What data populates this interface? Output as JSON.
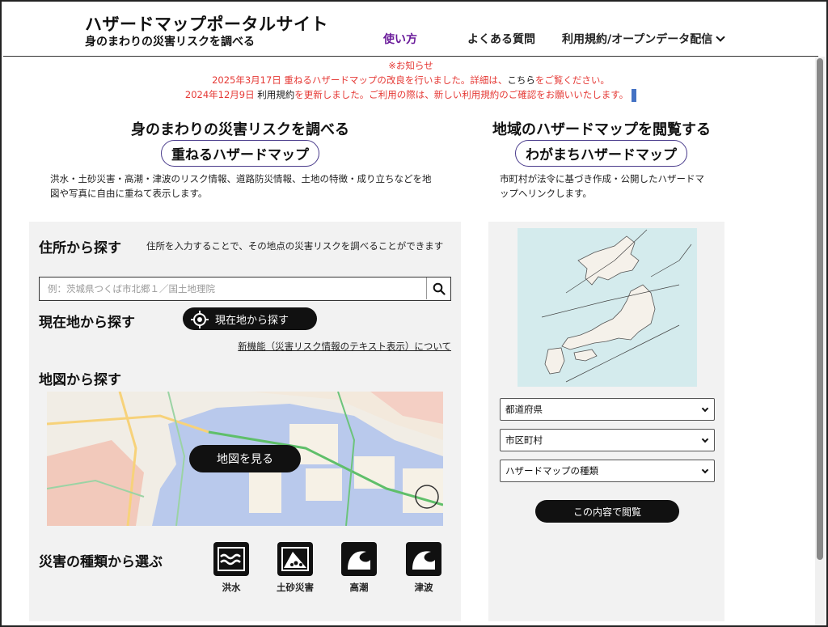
{
  "header": {
    "title": "ハザードマップポータルサイト",
    "subtitle": "身のまわりの災害リスクを調べる",
    "nav": {
      "usage": "使い方",
      "faq": "よくある質問",
      "terms": "利用規約/オープンデータ配信"
    }
  },
  "notices": {
    "heading": "※お知らせ",
    "line1_prefix": "2025年3月17日 重ねるハザードマップの改良を行いました。詳細は、",
    "line1_link": "こちら",
    "line1_suffix": "をご覧ください。",
    "line2_prefix": "2024年12月9日 ",
    "line2_link": "利用規約",
    "line2_suffix": "を更新しました。ご利用の際は、新しい利用規約のご確認をお願いいたします。"
  },
  "left": {
    "heading": "身のまわりの災害リスクを調べる",
    "pill": "重ねるハザードマップ",
    "desc_line1": "洪水・土砂災害・高潮・津波のリスク情報、道路防災情報、土地の特徴・成り立ちなどを地",
    "desc_line2": "図や写真に自由に重ねて表示します。",
    "address": {
      "label": "住所から探す",
      "note": "住所を入力することで、その地点の災害リスクを調べることができます",
      "placeholder": "例：茨城県つくば市北郷１／国土地理院"
    },
    "current": {
      "label": "現在地から探す",
      "button": "現在地から探す"
    },
    "new_feature": "新機能（災害リスク情報のテキスト表示）について",
    "map": {
      "label": "地図から探す",
      "button": "地図を見る"
    },
    "disaster": {
      "label": "災害の種類から選ぶ",
      "types": [
        "洪水",
        "土砂災害",
        "高潮",
        "津波"
      ]
    }
  },
  "right": {
    "heading": "地域のハザードマップを閲覧する",
    "pill": "わがまちハザードマップ",
    "desc_line1": "市町村が法令に基づき作成・公開したハザードマ",
    "desc_line2": "ップへリンクします。",
    "selects": {
      "prefecture": "都道府県",
      "municipality": "市区町村",
      "map_type": "ハザードマップの種類"
    },
    "view_button": "この内容で閲覧"
  },
  "colors": {
    "notice_red": "#e53935",
    "nav_active": "#6a1b9a",
    "pill_border": "#4a3c8c",
    "map_sea": "#d4ebed",
    "panel_bg": "#f2f2f2"
  }
}
